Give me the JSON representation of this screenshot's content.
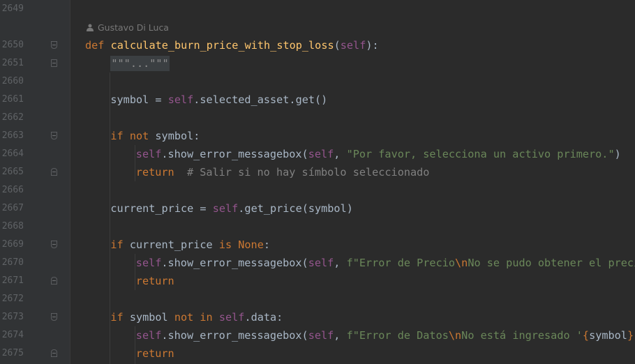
{
  "author": {
    "name": "Gustavo Di Luca",
    "icon": "person-icon"
  },
  "lines": [
    {
      "n": "2649",
      "fold": "",
      "indent": 0,
      "tokens": []
    },
    {
      "n": "2650",
      "fold": "open",
      "indent": 0,
      "tokens": [
        [
          "kw",
          "def "
        ],
        [
          "fn",
          "calculate_burn_price_with_stop_loss"
        ],
        [
          "",
          "("
        ],
        [
          "self",
          "self"
        ],
        [
          "",
          "):"
        ]
      ]
    },
    {
      "n": "2651",
      "fold": "plain",
      "indent": 1,
      "tokens": [
        [
          "folded",
          "\"\"\"...\"\"\""
        ]
      ]
    },
    {
      "n": "2660",
      "fold": "",
      "indent": 0,
      "tokens": []
    },
    {
      "n": "2661",
      "fold": "",
      "indent": 1,
      "tokens": [
        [
          "",
          "symbol = "
        ],
        [
          "self",
          "self"
        ],
        [
          "",
          ".selected_asset.get()"
        ]
      ]
    },
    {
      "n": "2662",
      "fold": "",
      "indent": 0,
      "tokens": []
    },
    {
      "n": "2663",
      "fold": "open",
      "indent": 1,
      "tokens": [
        [
          "kw",
          "if not "
        ],
        [
          "",
          "symbol:"
        ]
      ]
    },
    {
      "n": "2664",
      "fold": "",
      "indent": 2,
      "tokens": [
        [
          "self",
          "self"
        ],
        [
          "",
          ".show_error_messagebox("
        ],
        [
          "self",
          "self"
        ],
        [
          "",
          ", "
        ],
        [
          "str",
          "\"Por favor, selecciona un activo primero.\""
        ],
        [
          "",
          ")"
        ]
      ]
    },
    {
      "n": "2665",
      "fold": "close",
      "indent": 2,
      "tokens": [
        [
          "kw",
          "return"
        ],
        [
          "cmt",
          "  # Salir si no hay símbolo seleccionado"
        ]
      ]
    },
    {
      "n": "2666",
      "fold": "",
      "indent": 0,
      "tokens": []
    },
    {
      "n": "2667",
      "fold": "",
      "indent": 1,
      "tokens": [
        [
          "",
          "current_price = "
        ],
        [
          "self",
          "self"
        ],
        [
          "",
          ".get_price(symbol)"
        ]
      ]
    },
    {
      "n": "2668",
      "fold": "",
      "indent": 0,
      "tokens": []
    },
    {
      "n": "2669",
      "fold": "open",
      "indent": 1,
      "tokens": [
        [
          "kw",
          "if "
        ],
        [
          "",
          "current_price "
        ],
        [
          "kw",
          "is None"
        ],
        [
          "",
          ":"
        ]
      ]
    },
    {
      "n": "2670",
      "fold": "",
      "indent": 2,
      "tokens": [
        [
          "self",
          "self"
        ],
        [
          "",
          ".show_error_messagebox("
        ],
        [
          "self",
          "self"
        ],
        [
          "",
          ", "
        ],
        [
          "str",
          "f\"Error de Precio"
        ],
        [
          "esc",
          "\\n"
        ],
        [
          "str",
          "No se pudo obtener el precio"
        ]
      ]
    },
    {
      "n": "2671",
      "fold": "close",
      "indent": 2,
      "tokens": [
        [
          "kw",
          "return"
        ]
      ]
    },
    {
      "n": "2672",
      "fold": "",
      "indent": 0,
      "tokens": []
    },
    {
      "n": "2673",
      "fold": "open",
      "indent": 1,
      "tokens": [
        [
          "kw",
          "if "
        ],
        [
          "",
          "symbol "
        ],
        [
          "kw",
          "not in "
        ],
        [
          "self",
          "self"
        ],
        [
          "",
          ".data:"
        ]
      ]
    },
    {
      "n": "2674",
      "fold": "",
      "indent": 2,
      "tokens": [
        [
          "self",
          "self"
        ],
        [
          "",
          ".show_error_messagebox("
        ],
        [
          "self",
          "self"
        ],
        [
          "",
          ", "
        ],
        [
          "str",
          "f\"Error de Datos"
        ],
        [
          "esc",
          "\\n"
        ],
        [
          "str",
          "No está ingresado '"
        ],
        [
          "esc",
          "{"
        ],
        [
          "",
          "symbol"
        ],
        [
          "esc",
          "}"
        ],
        [
          "str",
          "'"
        ]
      ]
    },
    {
      "n": "2675",
      "fold": "close",
      "indent": 2,
      "tokens": [
        [
          "kw",
          "return"
        ]
      ]
    }
  ]
}
